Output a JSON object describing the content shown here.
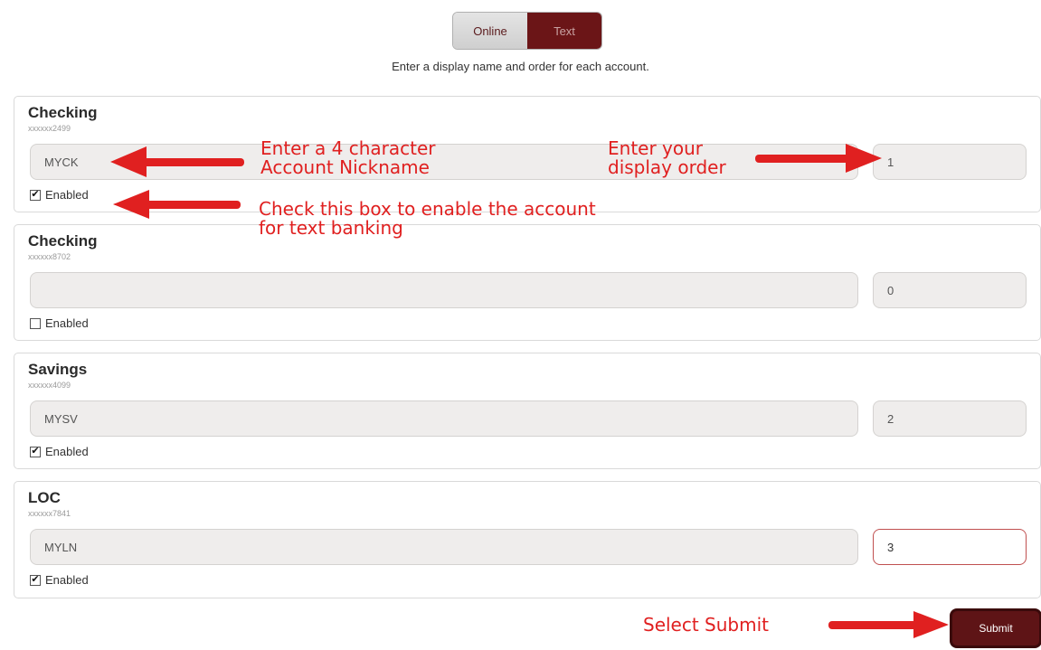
{
  "toggle": {
    "online_label": "Online",
    "text_label": "Text"
  },
  "instructions": "Enter a display name and order for each account.",
  "accounts": [
    {
      "name": "Checking",
      "number": "xxxxxx2499",
      "nickname": "MYCK",
      "order": "1",
      "enabled": true,
      "enabled_label": "Enabled"
    },
    {
      "name": "Checking",
      "number": "xxxxxx8702",
      "nickname": "",
      "order": "0",
      "enabled": false,
      "enabled_label": "Enabled"
    },
    {
      "name": "Savings",
      "number": "xxxxxx4099",
      "nickname": "MYSV",
      "order": "2",
      "enabled": true,
      "enabled_label": "Enabled"
    },
    {
      "name": "LOC",
      "number": "xxxxxx7841",
      "nickname": "MYLN",
      "order": "3",
      "enabled": true,
      "enabled_label": "Enabled"
    }
  ],
  "checkbox_glyphs": {
    "checked": "✔",
    "unchecked": ""
  },
  "submit_label": "Submit",
  "annotations": {
    "nickname_line1": "Enter a 4 character",
    "nickname_line2": "Account Nickname",
    "order_line1": "Enter your",
    "order_line2": "display order",
    "enable_line1": "Check this box to enable the account",
    "enable_line2": "for text banking",
    "submit": "Select Submit"
  },
  "colors": {
    "brand": "#6b1517",
    "annotation": "#e02020",
    "field_bg": "#efedec"
  }
}
